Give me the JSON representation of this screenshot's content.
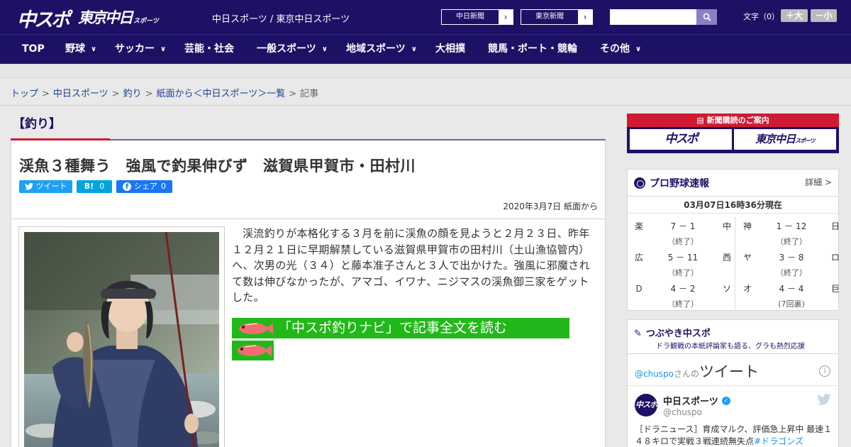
{
  "header": {
    "logo_chuspo": "中スポ",
    "logo_tokyo": "東京中日",
    "logo_tokyo_small": "スポーツ",
    "site_name": "中日スポーツ / 東京中日スポーツ",
    "site_buttons": [
      "中日新聞",
      "東京新聞"
    ],
    "search_placeholder": "",
    "font_size_label": "文字（0）",
    "font_bigger": "＋大",
    "font_smaller": "－小",
    "colors": {
      "header_bg": "#1d1166",
      "accent_red": "#d01a33",
      "promo_green": "#22b819"
    }
  },
  "nav": [
    {
      "label": "TOP",
      "dropdown": false
    },
    {
      "label": "野球",
      "dropdown": true
    },
    {
      "label": "サッカー",
      "dropdown": true
    },
    {
      "label": "芸能・社会",
      "dropdown": false
    },
    {
      "label": "一般スポーツ",
      "dropdown": true
    },
    {
      "label": "地域スポーツ",
      "dropdown": true
    },
    {
      "label": "大相撲",
      "dropdown": false
    },
    {
      "label": "競馬・ボート・競輪",
      "dropdown": false
    },
    {
      "label": "その他",
      "dropdown": true
    }
  ],
  "breadcrumb": {
    "links": [
      "トップ",
      "中日スポーツ",
      "釣り",
      "紙面から＜中日スポーツ＞一覧"
    ],
    "current": "記事"
  },
  "article": {
    "category": "【釣り】",
    "headline": "渓魚３種舞う　強風で釣果伸びず　滋賀県甲賀市・田村川",
    "share": {
      "tweet": "ツイート",
      "hatena": "B!",
      "hatena_count": "0",
      "facebook": "シェア",
      "facebook_count": "0"
    },
    "dateline": "2020年3月7日 紙面から",
    "body": "渓流釣りが本格化する３月を前に渓魚の顔を見ようと２月２３日、昨年１２月２１日に早期解禁している滋賀県甲賀市の田村川（土山漁協管内）へ、次男の光（３４）と藤本准子さんと３人で出かけた。強風に邪魔されて数は伸びなかったが、アマゴ、イワナ、ニジマスの渓魚御三家をゲットした。",
    "promo": "「中スポ釣りナビ」で記事全文を読む"
  },
  "sidebar": {
    "subscribe": {
      "title": "新聞購読のご案内",
      "logo1": "中スポ",
      "logo2": "東京中日",
      "logo2_small": "スポーツ"
    },
    "scores": {
      "title": "プロ野球速報",
      "detail": "詳細 >",
      "time": "03月07日16時36分現在",
      "games": [
        {
          "t1": "楽",
          "score": "7 － 1",
          "t2": "中",
          "status": "（終了）"
        },
        {
          "t1": "神",
          "score": "1 － 12",
          "t2": "日",
          "status": "（終了）"
        },
        {
          "t1": "広",
          "score": "5 － 11",
          "t2": "西",
          "status": "（終了）"
        },
        {
          "t1": "ヤ",
          "score": "3 － 8",
          "t2": "ロ",
          "status": "（終了）"
        },
        {
          "t1": "Ｄ",
          "score": "4 － 2",
          "t2": "ソ",
          "status": "（終了）"
        },
        {
          "t1": "オ",
          "score": "4 － 4",
          "t2": "巨",
          "status": "(7回裏)"
        }
      ]
    },
    "twitter": {
      "title": "つぶやき中スポ",
      "subtitle": "ドラ観戦の本紙評論家も語る、グラも熱烈応援",
      "handle_link": "@chuspo",
      "san": "さんの",
      "tweets_label": "ツイート",
      "info": "i",
      "avatar_text": "中スポ",
      "account_name": "中日スポーツ",
      "account_handle": "@chuspo",
      "tweet_text": "［ドラニュース］育成マルク、評価急上昇中 最速１４８キロで実戦３戦連続無失点",
      "tweet_hashtag": "#ドラゴンズ"
    }
  }
}
